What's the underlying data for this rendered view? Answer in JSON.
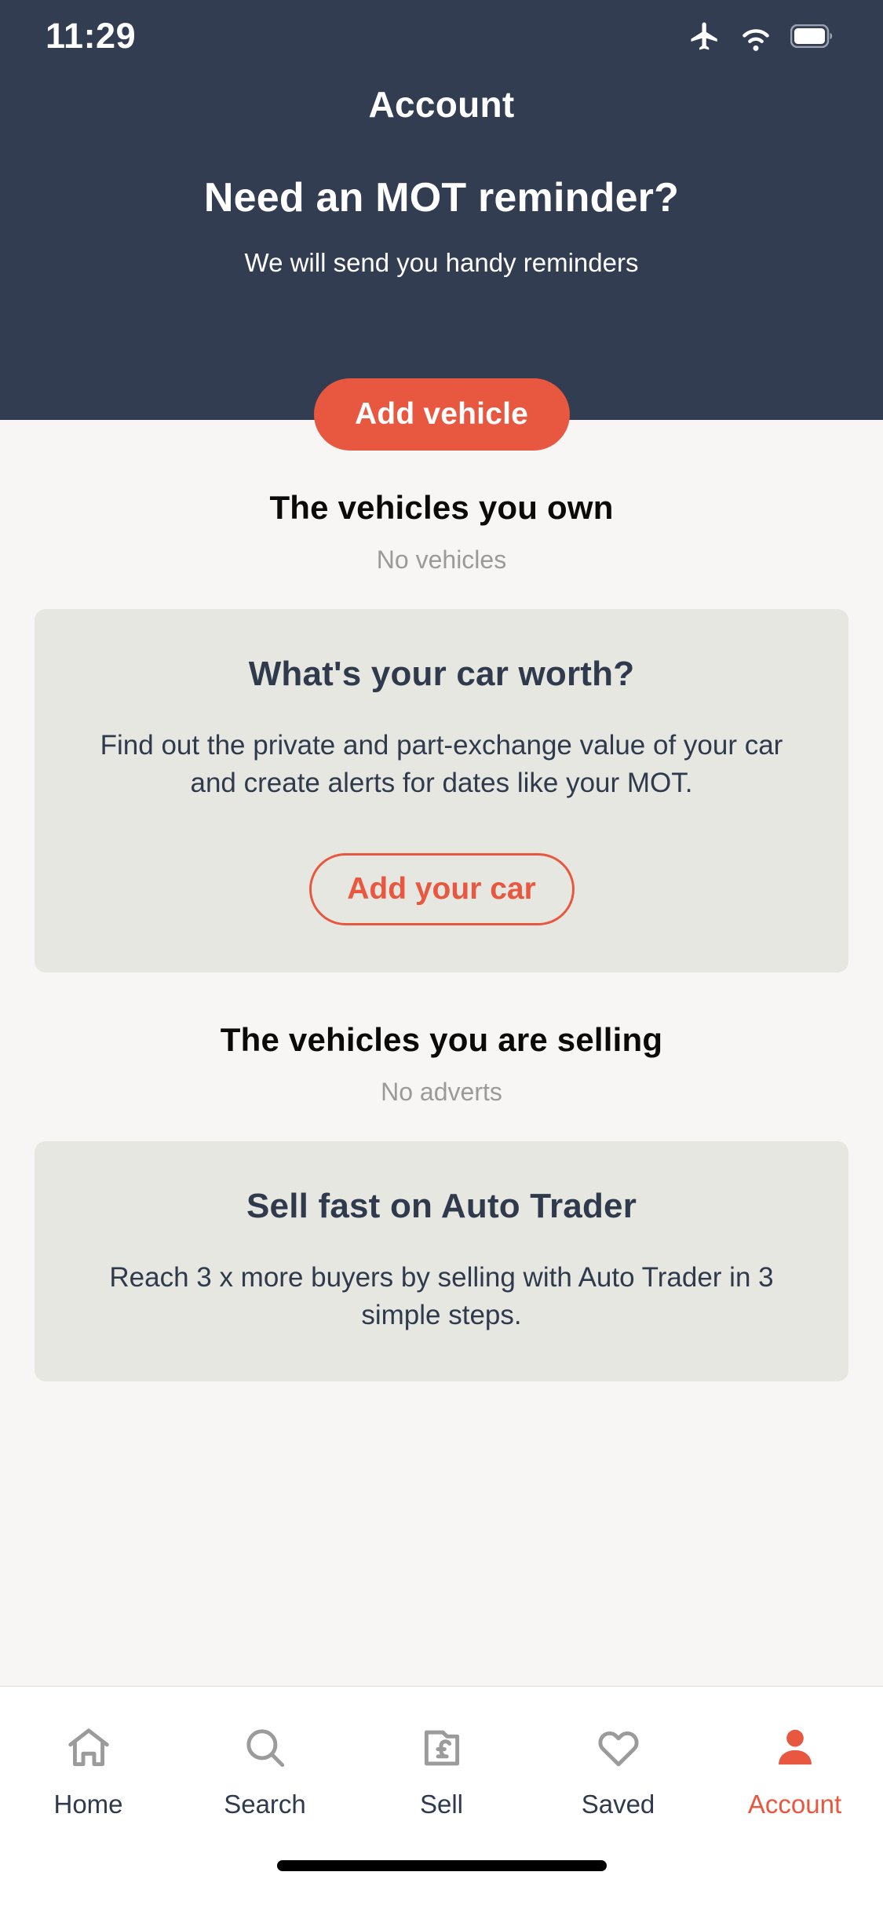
{
  "status_bar": {
    "time": "11:29",
    "icons": [
      "airplane-mode-icon",
      "wifi-icon",
      "battery-full-icon"
    ]
  },
  "header": {
    "title": "Account",
    "promo_heading": "Need an MOT reminder?",
    "promo_subtitle": "We will send you handy reminders",
    "add_vehicle_label": "Add vehicle",
    "background_color": "#333d51"
  },
  "sections": {
    "owned": {
      "title": "The vehicles you own",
      "empty_text": "No vehicles"
    },
    "selling": {
      "title": "The vehicles you are selling",
      "empty_text": "No adverts"
    }
  },
  "cards": {
    "valuation": {
      "title": "What's your car worth?",
      "body": "Find out the private and part-exchange value of your car and create alerts for dates like your MOT.",
      "button_label": "Add your car"
    },
    "sell": {
      "title": "Sell fast on Auto Trader",
      "body": "Reach 3 x more buyers by selling with Auto Trader in 3 simple steps."
    }
  },
  "tabbar": {
    "items": [
      {
        "label": "Home",
        "icon": "home-icon",
        "active": false
      },
      {
        "label": "Search",
        "icon": "search-icon",
        "active": false
      },
      {
        "label": "Sell",
        "icon": "pound-tag-icon",
        "active": false
      },
      {
        "label": "Saved",
        "icon": "heart-icon",
        "active": false
      },
      {
        "label": "Account",
        "icon": "person-icon",
        "active": true
      }
    ]
  },
  "colors": {
    "accent": "#e8573f",
    "dark": "#333d51",
    "page_bg": "#f7f6f4",
    "card_bg": "#e7e7e1",
    "muted": "#9a9a9a",
    "tab_inactive": "#9b9b9b"
  }
}
